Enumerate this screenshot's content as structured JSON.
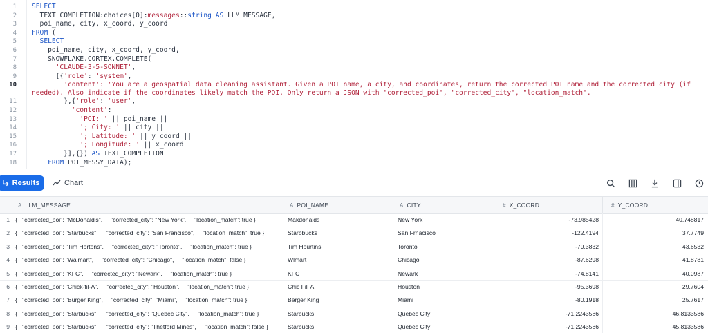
{
  "editor": {
    "lines": [
      {
        "n": "1",
        "tokens": [
          [
            "kw",
            "SELECT"
          ]
        ]
      },
      {
        "n": "2",
        "tokens": [
          [
            "id",
            "  TEXT_COMPLETION:choices[0]:"
          ],
          [
            "str",
            "messages"
          ],
          [
            "id",
            "::"
          ],
          [
            "kw",
            "string"
          ],
          [
            "id",
            " "
          ],
          [
            "kw",
            "AS"
          ],
          [
            "id",
            " LLM_MESSAGE,"
          ]
        ]
      },
      {
        "n": "3",
        "tokens": [
          [
            "id",
            "  poi_name, city, x_coord, y_coord"
          ]
        ]
      },
      {
        "n": "4",
        "tokens": [
          [
            "kw",
            "FROM"
          ],
          [
            "id",
            " ("
          ]
        ]
      },
      {
        "n": "5",
        "tokens": [
          [
            "kw",
            "  SELECT"
          ]
        ]
      },
      {
        "n": "6",
        "tokens": [
          [
            "id",
            "    poi_name, city, x_coord, y_coord,"
          ]
        ]
      },
      {
        "n": "7",
        "tokens": [
          [
            "id",
            "    SNOWFLAKE.CORTEX.COMPLETE("
          ]
        ]
      },
      {
        "n": "8",
        "tokens": [
          [
            "str",
            "      'CLAUDE-3-5-SONNET'"
          ],
          [
            "id",
            ","
          ]
        ]
      },
      {
        "n": "9",
        "tokens": [
          [
            "id",
            "      [{"
          ],
          [
            "str",
            "'role'"
          ],
          [
            "id",
            ": "
          ],
          [
            "str",
            "'system'"
          ],
          [
            "id",
            ","
          ]
        ]
      },
      {
        "n": "10",
        "active": true,
        "wrap": true,
        "tokens": [
          [
            "str",
            "        'content': 'You are a geospatial data cleaning assistant. Given a POI name, a city, and coordinates, return the corrected POI name and the corrected city (if needed). Also indicate if the coordinates likely match the POI. Only return a JSON with \"corrected_poi\", \"corrected_city\", \"location_match\".'"
          ]
        ]
      },
      {
        "n": "11",
        "tokens": [
          [
            "id",
            "        },{"
          ],
          [
            "str",
            "'role'"
          ],
          [
            "id",
            ": "
          ],
          [
            "str",
            "'user'"
          ],
          [
            "id",
            ","
          ]
        ]
      },
      {
        "n": "12",
        "tokens": [
          [
            "str",
            "          'content'"
          ],
          [
            "id",
            ":"
          ]
        ]
      },
      {
        "n": "13",
        "tokens": [
          [
            "str",
            "            'POI: '"
          ],
          [
            "id",
            " || poi_name ||"
          ]
        ]
      },
      {
        "n": "14",
        "tokens": [
          [
            "str",
            "            '; City: '"
          ],
          [
            "id",
            " || city ||"
          ]
        ]
      },
      {
        "n": "15",
        "tokens": [
          [
            "str",
            "            '; Latitude: '"
          ],
          [
            "id",
            " || y_coord ||"
          ]
        ]
      },
      {
        "n": "16",
        "tokens": [
          [
            "str",
            "            '; Longitude: '"
          ],
          [
            "id",
            " || x_coord"
          ]
        ]
      },
      {
        "n": "17",
        "tokens": [
          [
            "id",
            "        }],{}) "
          ],
          [
            "kw",
            "AS"
          ],
          [
            "id",
            " TEXT_COMPLETION"
          ]
        ]
      },
      {
        "n": "18",
        "tokens": [
          [
            "kw",
            "    FROM"
          ],
          [
            "id",
            " POI_MESSY_DATA);"
          ]
        ]
      }
    ]
  },
  "toolbar": {
    "results_label": "Results",
    "chart_label": "Chart",
    "accent": "#1a6ce8"
  },
  "table": {
    "columns": [
      "LLM_MESSAGE",
      "POI_NAME",
      "CITY",
      "X_COORD",
      "Y_COORD"
    ],
    "column_types": [
      "A",
      "A",
      "A",
      "#",
      "#"
    ],
    "rows": [
      [
        "1",
        "{   \"corrected_poi\": \"McDonald's\",     \"corrected_city\": \"New York\",     \"location_match\": true }",
        "Makdonalds",
        "New York",
        "-73.985428",
        "40.748817"
      ],
      [
        "2",
        "{   \"corrected_poi\": \"Starbucks\",     \"corrected_city\": \"San Francisco\",     \"location_match\": true }",
        "Starbbucks",
        "San Frnacisco",
        "-122.4194",
        "37.7749"
      ],
      [
        "3",
        "{   \"corrected_poi\": \"Tim Hortons\",     \"corrected_city\": \"Toronto\",     \"location_match\": true }",
        "Tim Hourtins",
        "Toronto",
        "-79.3832",
        "43.6532"
      ],
      [
        "4",
        "{   \"corrected_poi\": \"Walmart\",     \"corrected_city\": \"Chicago\",     \"location_match\": false }",
        "Wlmart",
        "Chicago",
        "-87.6298",
        "41.8781"
      ],
      [
        "5",
        "{   \"corrected_poi\": \"KFC\",     \"corrected_city\": \"Newark\",     \"location_match\": true }",
        "KFC",
        "Newark",
        "-74.8141",
        "40.0987"
      ],
      [
        "6",
        "{   \"corrected_poi\": \"Chick-fil-A\",     \"corrected_city\": \"Houston\",     \"location_match\": true }",
        "Chic Fill A",
        "Houston",
        "-95.3698",
        "29.7604"
      ],
      [
        "7",
        "{   \"corrected_poi\": \"Burger King\",     \"corrected_city\": \"Miami\",     \"location_match\": true }",
        "Berger King",
        "Miami",
        "-80.1918",
        "25.7617"
      ],
      [
        "8",
        "{   \"corrected_poi\": \"Starbucks\",     \"corrected_city\": \"Québec City\",     \"location_match\": true }",
        "Starbucks",
        "Quebec City",
        "-71.2243586",
        "46.8133586"
      ],
      [
        "9",
        "{   \"corrected_poi\": \"Starbucks\",     \"corrected_city\": \"Thetford Mines\",     \"location_match\": false }",
        "Starbucks",
        "Quebec City",
        "-71.2243586",
        "45.8133586"
      ]
    ]
  },
  "icons": {
    "results": "results-arrow-icon",
    "chart": "chart-line-icon",
    "search": "search-icon",
    "columns": "columns-icon",
    "download": "download-icon",
    "panel": "panel-icon",
    "history": "clock-icon"
  }
}
